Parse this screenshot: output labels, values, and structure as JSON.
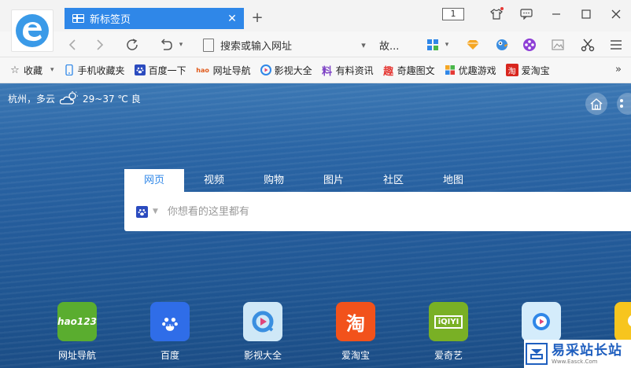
{
  "browser": {
    "tab": {
      "title": "新标签页",
      "close": "✕"
    },
    "new_tab": "+",
    "tab_count": "1",
    "address": {
      "placeholder": "搜索或输入网址",
      "extra": "故..."
    }
  },
  "bookmarks": [
    {
      "label": "收藏",
      "icon": "star-icon"
    },
    {
      "label": "手机收藏夹",
      "icon": "phone-icon"
    },
    {
      "label": "百度一下",
      "icon": "baidu-paw-icon"
    },
    {
      "label": "网址导航",
      "icon": "hao123-icon"
    },
    {
      "label": "影视大全",
      "icon": "video-icon"
    },
    {
      "label": "有料资讯",
      "icon": "news-icon"
    },
    {
      "label": "奇趣图文",
      "icon": "fun-icon"
    },
    {
      "label": "优趣游戏",
      "icon": "game-icon"
    },
    {
      "label": "爱淘宝",
      "icon": "taobao-icon"
    }
  ],
  "bookmarks_more": "»",
  "weather": {
    "city": "杭州，多云",
    "temp": "29~37 ℃ 良"
  },
  "search": {
    "tabs": [
      "网页",
      "视频",
      "购物",
      "图片",
      "社区",
      "地图"
    ],
    "placeholder": "你想看的这里都有"
  },
  "quick_links": [
    {
      "label": "网址导航",
      "tile_text": "hao123",
      "color": "#5aad2f"
    },
    {
      "label": "百度",
      "tile_text": "du",
      "color": "#2f6de8"
    },
    {
      "label": "影视大全",
      "tile_text": "",
      "color": "#cfe8f7"
    },
    {
      "label": "爱淘宝",
      "tile_text": "淘",
      "color": "#f2521b"
    },
    {
      "label": "爱奇艺",
      "tile_text": "iQIYI",
      "color": "#79b025"
    },
    {
      "label": "",
      "tile_text": "",
      "color": "#d4ecfb"
    }
  ],
  "watermark": {
    "title": "易采站长站",
    "sub": "Www.Easck.Com"
  },
  "colors": {
    "accent": "#2f87e8",
    "sea": "#2b66a6"
  }
}
